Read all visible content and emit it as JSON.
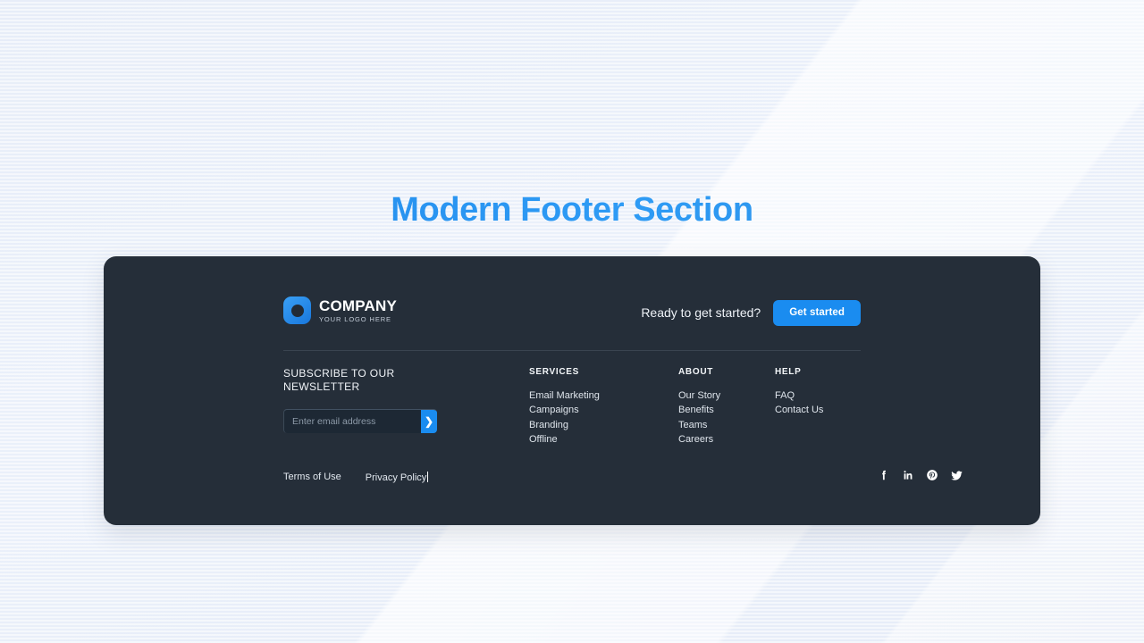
{
  "page": {
    "title": "Modern Footer Section",
    "background_color": "#e9eff9",
    "accent_color": "#1a8cf0"
  },
  "footer": {
    "panel_color": "#252e39",
    "brand": {
      "logo_icon": "rounded-square-circle-logo-icon",
      "name": "COMPANY",
      "tagline": "YOUR LOGO HERE"
    },
    "cta": {
      "text": "Ready to get started?",
      "button_label": "Get started"
    },
    "subscribe": {
      "heading": "SUBSCRIBE TO OUR\nNEWSLETTER",
      "input_value": "",
      "input_placeholder": "Enter email address",
      "submit_icon": "chevron-right-icon",
      "submit_glyph": "❯"
    },
    "columns": [
      {
        "heading": "SERVICES",
        "links": [
          "Email Marketing",
          "Campaigns",
          "Branding",
          "Offline"
        ]
      },
      {
        "heading": "ABOUT",
        "links": [
          "Our Story",
          "Benefits",
          "Teams",
          "Careers"
        ]
      },
      {
        "heading": "HELP",
        "links": [
          "FAQ",
          "Contact Us"
        ]
      }
    ],
    "legal": [
      {
        "label": "Terms of Use"
      },
      {
        "label": "Privacy Policy"
      }
    ],
    "social": [
      {
        "name": "facebook-icon"
      },
      {
        "name": "linkedin-icon"
      },
      {
        "name": "pinterest-icon"
      },
      {
        "name": "twitter-icon"
      }
    ]
  }
}
